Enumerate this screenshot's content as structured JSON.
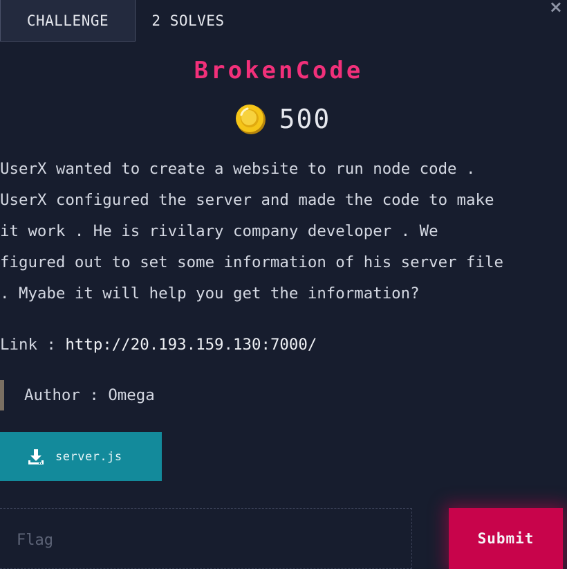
{
  "tabs": [
    {
      "label": "CHALLENGE",
      "active": true
    },
    {
      "label": "2 SOLVES",
      "active": false
    }
  ],
  "close_label": "×",
  "challenge": {
    "title": "BrokenCode",
    "points": "500",
    "description_lines": [
      "UserX wanted to create a website to run node code .",
      "UserX configured the server and made the code to make",
      "it work . He is rivilary company developer . We",
      "figured out to set some information of his server file",
      ". Myabe it will help you get the information?"
    ],
    "link_prefix": "Link : ",
    "link_url": "http://20.193.159.130:7000/",
    "author": "Author : Omega",
    "file_name": "server.js"
  },
  "flag": {
    "placeholder": "Flag",
    "submit_label": "Submit"
  },
  "colors": {
    "background": "#171d2e",
    "title": "#f2307a",
    "file_button": "#138a9b",
    "submit_button": "#c8044b",
    "coin": "#f5c518"
  },
  "icons": {
    "coin": "coin-icon",
    "download": "download-icon",
    "close": "close-icon"
  }
}
